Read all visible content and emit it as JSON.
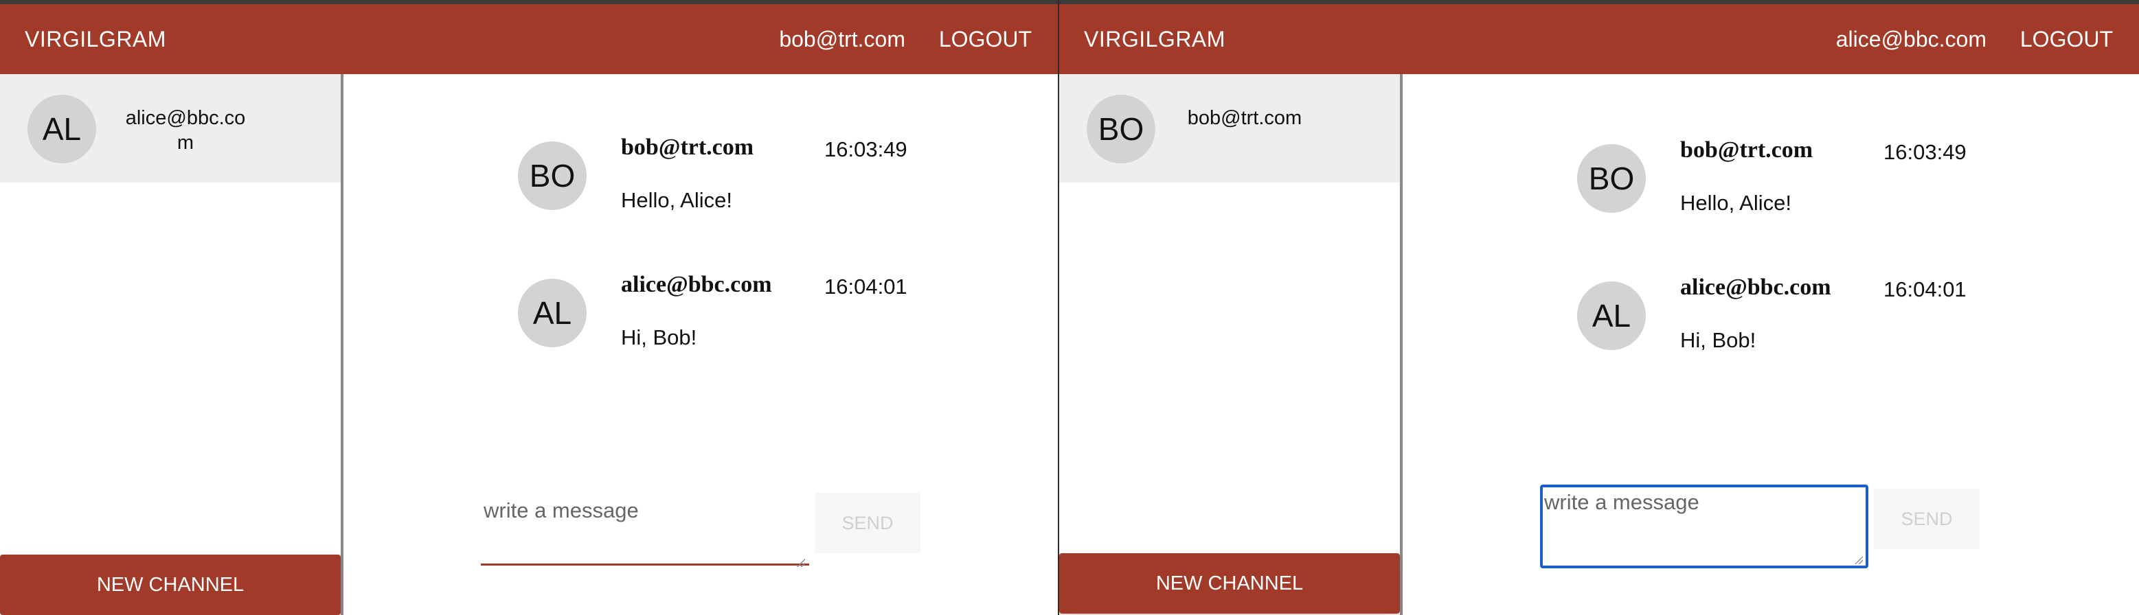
{
  "left_window": {
    "header": {
      "brand": "VIRGILGRAM",
      "user_email": "bob@trt.com",
      "logout_label": "LOGOUT"
    },
    "sidebar": {
      "channels": [
        {
          "avatar": "AL",
          "name": "alice@bbc.com"
        }
      ],
      "new_channel_label": "NEW CHANNEL"
    },
    "messages": [
      {
        "avatar": "BO",
        "author": "bob@trt.com",
        "time": "16:03:49",
        "text": "Hello, Alice!"
      },
      {
        "avatar": "AL",
        "author": "alice@bbc.com",
        "time": "16:04:01",
        "text": "Hi, Bob!"
      }
    ],
    "composer": {
      "placeholder": "write a message",
      "value": "",
      "send_label": "SEND"
    }
  },
  "right_window": {
    "header": {
      "brand": "VIRGILGRAM",
      "user_email": "alice@bbc.com",
      "logout_label": "LOGOUT"
    },
    "sidebar": {
      "channels": [
        {
          "avatar": "BO",
          "name": "bob@trt.com"
        }
      ],
      "new_channel_label": "NEW CHANNEL"
    },
    "messages": [
      {
        "avatar": "BO",
        "author": "bob@trt.com",
        "time": "16:03:49",
        "text": "Hello, Alice!"
      },
      {
        "avatar": "AL",
        "author": "alice@bbc.com",
        "time": "16:04:01",
        "text": "Hi, Bob!"
      }
    ],
    "composer": {
      "placeholder": "write a message",
      "value": "",
      "send_label": "SEND"
    }
  },
  "colors": {
    "brand": "#a23a2a",
    "sidebar_active_bg": "#eeeeee",
    "avatar_bg": "#d3d3d3",
    "focus_ring": "#1a5fc7",
    "send_disabled_text": "#cfcfcf"
  }
}
